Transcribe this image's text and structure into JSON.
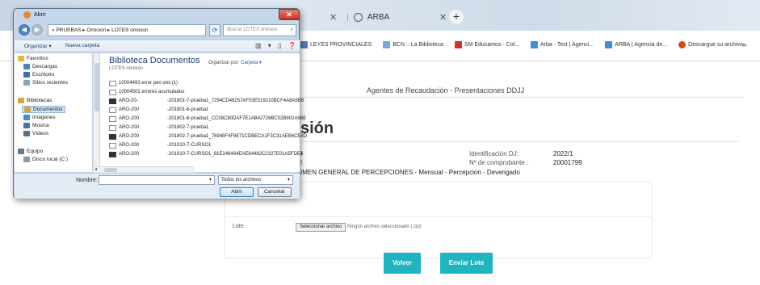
{
  "browser": {
    "tabs": [
      {
        "label": ""
      },
      {
        "label": "ARBA"
      }
    ],
    "bookmarks": [
      {
        "label": "LEYES PROVINCIALES",
        "color": "#4b7bc4"
      },
      {
        "label": "BCN :: La Biblioteca",
        "color": "#7aa6d6"
      },
      {
        "label": "SM Educamos - Col...",
        "color": "#d62e2e"
      },
      {
        "label": "Arba - Test | Agenci...",
        "color": "#3a8de0"
      },
      {
        "label": "ARBA | Agencia de...",
        "color": "#3a8de0"
      },
      {
        "label": "Descargue su archivo...",
        "color": "#d04b1f"
      }
    ],
    "more_label": "»"
  },
  "page": {
    "header": "Agentes de Recaudación - Presentaciones DDJJ",
    "title": "sión",
    "left_stub_1": "I",
    "left_stub_2": "I",
    "ident_label": "Identificación DJ:",
    "ident_value": "2022/1",
    "comp_label": "Nº de comprobante :",
    "comp_value": "20001799",
    "regimen": "IMEN GENERAL DE PERCEPCIONES - Mensual - Percepcion - Devengado",
    "lote_label": "Lote",
    "file_button": "Seleccionar archivo",
    "file_status": "Ningún archivo seleccionado (.zip)",
    "volver": "Volver",
    "enviar": "Enviar Lote",
    "accent": "#1fb5c0"
  },
  "dialog": {
    "title": "Abrir",
    "close_label": "✕",
    "breadcrumb": "« PRUEBAS ▸ Omision ▸ LOTES omision",
    "search_placeholder": "Buscar LOTES omision",
    "toolbar": {
      "organize": "Organizar ▾",
      "new_folder": "Nueva carpeta",
      "icons": "▥ ▾ ▯ ❓"
    },
    "sidebar": [
      {
        "label": "Favoritos",
        "color": "#e6b53a"
      },
      {
        "label": "Descargas",
        "color": "#4a7fc1"
      },
      {
        "label": "Escritorio",
        "color": "#3d6fb0"
      },
      {
        "label": "Sitios recientes",
        "color": "#8aa3c0"
      },
      {
        "label": "Bibliotecas",
        "color": "#d9a441"
      },
      {
        "label": "Documentos",
        "color": "#d9a441"
      },
      {
        "label": "Imágenes",
        "color": "#3f8fd6"
      },
      {
        "label": "Música",
        "color": "#4b6fb0"
      },
      {
        "label": "Vídeos",
        "color": "#5a6f8a"
      },
      {
        "label": "Equipo",
        "color": "#607890"
      },
      {
        "label": "Disco local (C:)",
        "color": "#8899aa"
      }
    ],
    "library_title": "Biblioteca Documentos",
    "library_sub": "LOTES omision",
    "organize_by_label": "Organizar por:",
    "organize_by_value": "Carpeta ▾",
    "files": [
      {
        "c1": "10004493 error peri omi (1)",
        "c2": "",
        "dark": false
      },
      {
        "c1": "10004502 errores acumulados",
        "c2": "",
        "dark": false
      },
      {
        "c1": "ARO-20-",
        "c2": "-201801-7-prueba1_7294CD48257AF03E519210BCF4A8A5B6",
        "dark": true
      },
      {
        "c1": "ARO-200",
        "c2": "-201801-6-prueba1",
        "dark": false
      },
      {
        "c1": "ARO-200",
        "c2": "-201801-6-prueba1_CC08C80DAF7E1AB42726BC02B902A96E",
        "dark": false
      },
      {
        "c1": "ARO-200",
        "c2": "-201802-7-prueba1",
        "dark": false
      },
      {
        "c1": "ARO-200",
        "c2": "-201802-7-prueba1_76948F4F8871CDBECA1F3C31AEB6CE8D",
        "dark": true
      },
      {
        "c1": "ARO-200",
        "c2": "-201910-7-CURSO1",
        "dark": false
      },
      {
        "c1": "ARO-200",
        "c2": "-201910-7-CURSO1_81E246464EAE84482C2327E01A5FDE4",
        "dark": true
      }
    ],
    "filename_label": "Nombre:",
    "filename_value": "",
    "filetype": "Todos los archivos",
    "open_label": "Abrir",
    "cancel_label": "Cancelar"
  }
}
